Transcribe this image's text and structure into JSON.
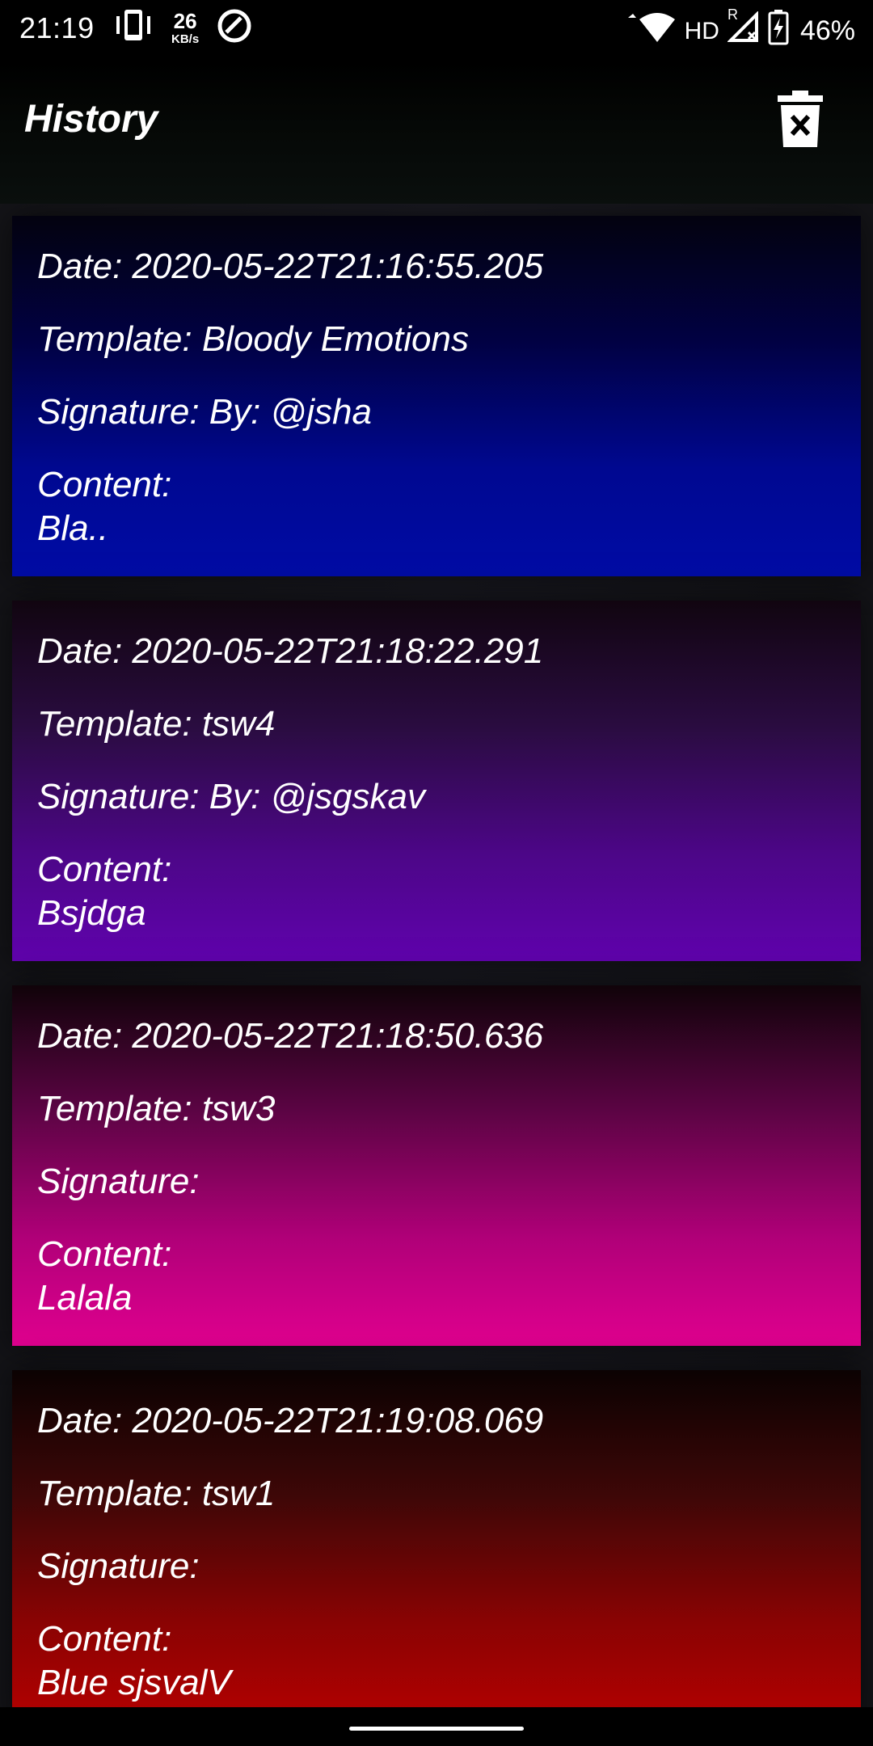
{
  "status_bar": {
    "time": "21:19",
    "net_speed_value": "26",
    "net_speed_unit": "KB/s",
    "network_label": "HD",
    "roaming_label": "R",
    "battery": "46%"
  },
  "header": {
    "title": "History",
    "delete_icon": "trash-x-icon"
  },
  "history": [
    {
      "date": "Date: 2020-05-22T21:16:55.205",
      "template": "Template: Bloody Emotions",
      "signature": "Signature: By: @jsha",
      "content_label": "Content:",
      "content": "Bla.."
    },
    {
      "date": "Date: 2020-05-22T21:18:22.291",
      "template": "Template: tsw4",
      "signature": "Signature: By: @jsgskav",
      "content_label": "Content:",
      "content": "Bsjdga"
    },
    {
      "date": "Date: 2020-05-22T21:18:50.636",
      "template": "Template: tsw3",
      "signature": "Signature:",
      "content_label": "Content:",
      "content": "Lalala"
    },
    {
      "date": "Date: 2020-05-22T21:19:08.069",
      "template": "Template: tsw1",
      "signature": "Signature:",
      "content_label": "Content:",
      "content": "Blue sjsvalV"
    }
  ],
  "colors": {
    "card_1": "#000ca6",
    "card_2": "#6003ad",
    "card_3": "#e0008f",
    "card_4": "#b70000"
  }
}
